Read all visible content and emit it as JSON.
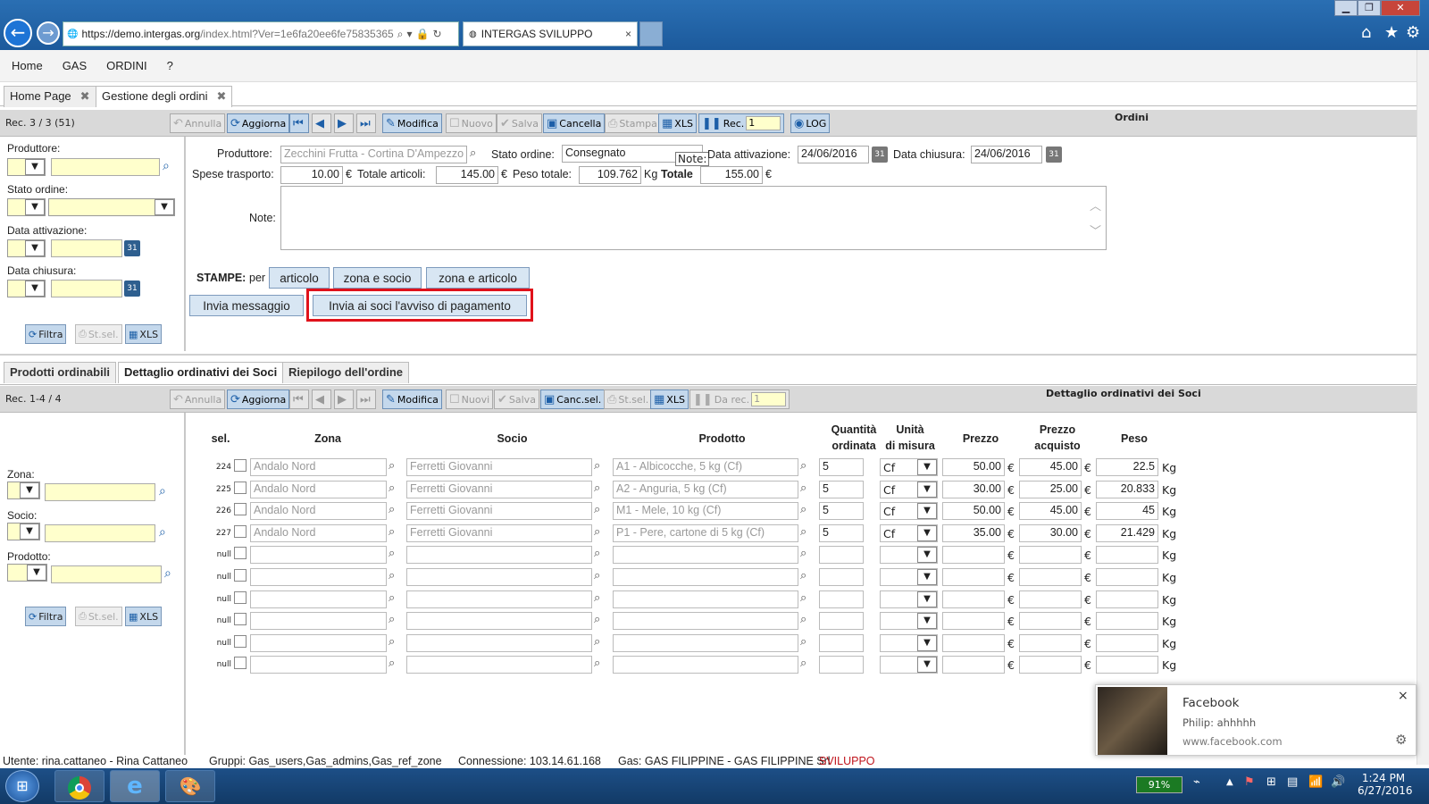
{
  "browser": {
    "url_host": "https://demo.",
    "url_domain": "intergas.org",
    "url_path": "/index.html?Ver=1e6fa20ee6fe75835365",
    "tab_title": "INTERGAS SVILUPPO",
    "tab_close": "×"
  },
  "menu": [
    "Home",
    "GAS",
    "ORDINI",
    "?"
  ],
  "app_tabs": [
    {
      "label": "Home Page"
    },
    {
      "label": "Gestione degli ordini"
    }
  ],
  "tab_close": "✖",
  "toolbar1": {
    "rec": "Rec. 3 / 3 (51)",
    "annulla": "Annulla",
    "aggiorna": "Aggiorna",
    "modifica": "Modifica",
    "nuovo": "Nuovo",
    "salva": "Salva",
    "cancella": "Cancella",
    "stampa": "Stampa",
    "xls": "XLS",
    "rec_label": "Rec.",
    "rec_value": "1",
    "log": "LOG",
    "section_title": "Ordini"
  },
  "filter1": {
    "produttore": "Produttore:",
    "stato": "Stato ordine:",
    "data_att": "Data attivazione:",
    "data_chius": "Data chiusura:",
    "filtra": "Filtra",
    "stsel": "St.sel.",
    "xls": "XLS"
  },
  "order": {
    "produttore_label": "Produttore:",
    "produttore_value": "Zecchini Frutta - Cortina D'Ampezzo",
    "stato_label": "Stato ordine:",
    "stato_value": "Consegnato",
    "data_att_label": "Data attivazione:",
    "data_att_value": "24/06/2016",
    "data_chius_label": "Data chiusura:",
    "data_chius_value": "24/06/2016",
    "spese_label": "Spese trasporto:",
    "spese_value": "10.00",
    "tot_art_label": "Totale articoli:",
    "tot_art_value": "145.00",
    "peso_label": "Peso totale:",
    "peso_value": "109.762",
    "totale_label": "Totale",
    "totale_value": "155.00",
    "euro": "€",
    "kg": "Kg",
    "note_label": "Note:",
    "note_tooltip": "Note:",
    "stampe_label": "STAMPE:",
    "stampe_per": "per",
    "print_buttons": [
      "articolo",
      "zona e socio",
      "zona e articolo"
    ],
    "invia_msg": "Invia messaggio",
    "invia_avviso": "Invia ai soci l'avviso di pagamento",
    "cal": "31"
  },
  "lower_tabs": [
    {
      "label": "Prodotti ordinabili"
    },
    {
      "label": "Dettaglio ordinativi dei Soci"
    },
    {
      "label": "Riepilogo dell'ordine"
    }
  ],
  "toolbar2": {
    "rec": "Rec. 1-4 / 4",
    "annulla": "Annulla",
    "aggiorna": "Aggiorna",
    "modifica": "Modifica",
    "nuovi": "Nuovi",
    "salva": "Salva",
    "cancsel": "Canc.sel.",
    "stsel": "St.sel.",
    "xls": "XLS",
    "darec": "Da rec.",
    "darec_value": "1",
    "section_title": "Dettaglio ordinativi dei Soci"
  },
  "filter2": {
    "zona": "Zona:",
    "socio": "Socio:",
    "prodotto": "Prodotto:",
    "filtra": "Filtra",
    "stsel": "St.sel.",
    "xls": "XLS"
  },
  "grid": {
    "headers": {
      "sel": "sel.",
      "zona": "Zona",
      "socio": "Socio",
      "prodotto": "Prodotto",
      "qta1": "Quantità",
      "qta2": "ordinata",
      "um1": "Unità",
      "um2": "di misura",
      "prezzo": "Prezzo",
      "pa1": "Prezzo",
      "pa2": "acquisto",
      "peso": "Peso"
    },
    "euro": "€",
    "kg": "Kg",
    "rows": [
      {
        "id": "224",
        "zona": "Andalo Nord",
        "socio": "Ferretti Giovanni",
        "prodotto": "A1 - Albicocche, 5 kg (Cf)",
        "qta": "5",
        "um": "Cf",
        "prezzo": "50.00",
        "acquisto": "45.00",
        "peso": "22.5"
      },
      {
        "id": "225",
        "zona": "Andalo Nord",
        "socio": "Ferretti Giovanni",
        "prodotto": "A2 - Anguria, 5 kg (Cf)",
        "qta": "5",
        "um": "Cf",
        "prezzo": "30.00",
        "acquisto": "25.00",
        "peso": "20.833"
      },
      {
        "id": "226",
        "zona": "Andalo Nord",
        "socio": "Ferretti Giovanni",
        "prodotto": "M1 - Mele, 10 kg (Cf)",
        "qta": "5",
        "um": "Cf",
        "prezzo": "50.00",
        "acquisto": "45.00",
        "peso": "45"
      },
      {
        "id": "227",
        "zona": "Andalo Nord",
        "socio": "Ferretti Giovanni",
        "prodotto": "P1 - Pere, cartone di 5 kg (Cf)",
        "qta": "5",
        "um": "Cf",
        "prezzo": "35.00",
        "acquisto": "30.00",
        "peso": "21.429"
      },
      {
        "id": "null",
        "zona": "",
        "socio": "",
        "prodotto": "",
        "qta": "",
        "um": "",
        "prezzo": "",
        "acquisto": "",
        "peso": ""
      },
      {
        "id": "null",
        "zona": "",
        "socio": "",
        "prodotto": "",
        "qta": "",
        "um": "",
        "prezzo": "",
        "acquisto": "",
        "peso": ""
      },
      {
        "id": "null",
        "zona": "",
        "socio": "",
        "prodotto": "",
        "qta": "",
        "um": "",
        "prezzo": "",
        "acquisto": "",
        "peso": ""
      },
      {
        "id": "null",
        "zona": "",
        "socio": "",
        "prodotto": "",
        "qta": "",
        "um": "",
        "prezzo": "",
        "acquisto": "",
        "peso": ""
      },
      {
        "id": "null",
        "zona": "",
        "socio": "",
        "prodotto": "",
        "qta": "",
        "um": "",
        "prezzo": "",
        "acquisto": "",
        "peso": ""
      },
      {
        "id": "null",
        "zona": "",
        "socio": "",
        "prodotto": "",
        "qta": "",
        "um": "",
        "prezzo": "",
        "acquisto": "",
        "peso": ""
      }
    ]
  },
  "status": {
    "utente": "Utente: rina.cattaneo - Rina Cattaneo",
    "gruppi": "Gruppi: Gas_users,Gas_admins,Gas_ref_zone",
    "connessione": "Connessione: 103.14.61.168",
    "gas": "Gas: GAS FILIPPINE - GAS FILIPPINE Srl",
    "env": "SVILUPPO",
    "env_color": "#c0141c"
  },
  "toast": {
    "app": "Facebook",
    "message": "Philip: ahhhhh",
    "site": "www.facebook.com",
    "close": "×"
  },
  "taskbar": {
    "battery": "91%",
    "time": "1:24 PM",
    "date": "6/27/2016"
  }
}
